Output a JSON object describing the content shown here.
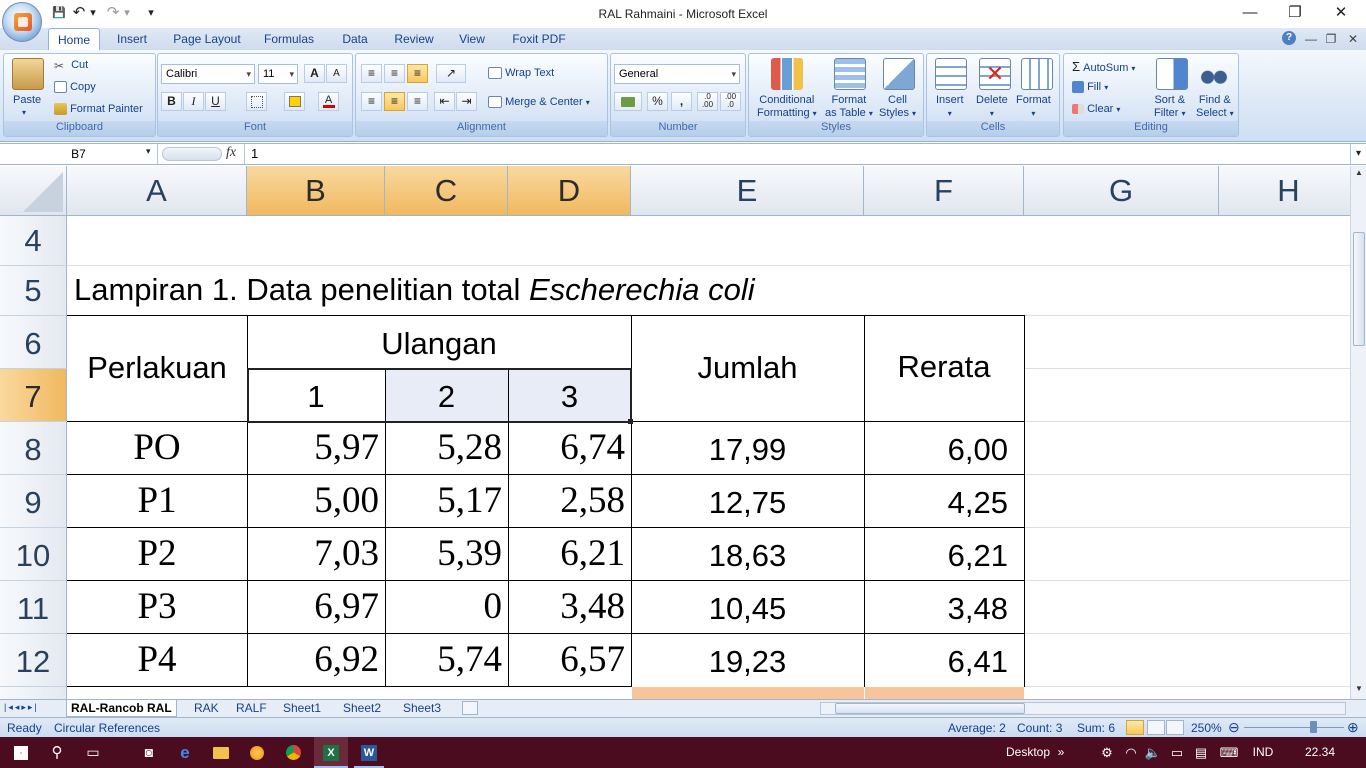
{
  "window": {
    "title": "RAL Rahmaini - Microsoft Excel",
    "minimize": "—",
    "restore": "❐",
    "close": "✕"
  },
  "qat": {
    "save": "💾",
    "undo": "↶",
    "undo_drop": "▾",
    "redo": "↷",
    "redo_drop": "▾",
    "customize": "▾"
  },
  "tabs": [
    "Home",
    "Insert",
    "Page Layout",
    "Formulas",
    "Data",
    "Review",
    "View",
    "Foxit PDF"
  ],
  "ribbon_right": {
    "help": "?",
    "min": "—",
    "restore": "❐",
    "close": "✕"
  },
  "clipboard": {
    "label": "Clipboard",
    "paste": "Paste",
    "cut": "Cut",
    "copy": "Copy",
    "format_painter": "Format Painter"
  },
  "font": {
    "label": "Font",
    "name": "Calibri",
    "size": "11",
    "bold": "B",
    "italic": "I",
    "underline": "U",
    "grow": "A",
    "shrink": "A"
  },
  "alignment": {
    "label": "Alignment",
    "wrap": "Wrap Text",
    "merge": "Merge & Center"
  },
  "number": {
    "label": "Number",
    "format": "General",
    "percent": "%",
    "comma": ",",
    "inc": ".0 .00",
    "dec": ".00 .0"
  },
  "styles": {
    "label": "Styles",
    "conditional": [
      "Conditional",
      "Formatting"
    ],
    "format_table": [
      "Format",
      "as Table"
    ],
    "cell_styles": [
      "Cell",
      "Styles"
    ]
  },
  "cells": {
    "label": "Cells",
    "insert": "Insert",
    "delete": "Delete",
    "format": "Format"
  },
  "editing": {
    "label": "Editing",
    "autosum": "AutoSum",
    "fill": "Fill",
    "clear": "Clear",
    "sort": [
      "Sort &",
      "Filter"
    ],
    "find": [
      "Find &",
      "Select"
    ]
  },
  "formula_bar": {
    "name_box": "B7",
    "fx": "fx",
    "value": "1"
  },
  "columns": [
    "A",
    "B",
    "C",
    "D",
    "E",
    "F",
    "G",
    "H"
  ],
  "rows": [
    "4",
    "5",
    "6",
    "7",
    "8",
    "9",
    "10",
    "11",
    "12"
  ],
  "sheet": {
    "title_plain": "Lampiran 1. Data penelitian total ",
    "title_italic": "Escherechia coli",
    "header_perlakuan": "Perlakuan",
    "header_ulangan": "Ulangan",
    "header_jumlah": "Jumlah",
    "header_rerata": "Rerata",
    "rep_labels": [
      "1",
      "2",
      "3"
    ],
    "data": [
      {
        "p": "PO",
        "u1": "5,97",
        "u2": "5,28",
        "u3": "6,74",
        "jumlah": "17,99",
        "rerata": "6,00"
      },
      {
        "p": "P1",
        "u1": "5,00",
        "u2": "5,17",
        "u3": "2,58",
        "jumlah": "12,75",
        "rerata": "4,25"
      },
      {
        "p": "P2",
        "u1": "7,03",
        "u2": "5,39",
        "u3": "6,21",
        "jumlah": "18,63",
        "rerata": "6,21"
      },
      {
        "p": "P3",
        "u1": "6,97",
        "u2": "0",
        "u3": "3,48",
        "jumlah": "10,45",
        "rerata": "3,48"
      },
      {
        "p": "P4",
        "u1": "6,92",
        "u2": "5,74",
        "u3": "6,57",
        "jumlah": "19,23",
        "rerata": "6,41"
      }
    ]
  },
  "sheet_tabs": [
    "RAL-Rancob RAL",
    "RAK",
    "RALF",
    "Sheet1",
    "Sheet2",
    "Sheet3"
  ],
  "status": {
    "ready": "Ready",
    "circular": "Circular References",
    "average": "Average: 2",
    "count": "Count: 3",
    "sum": "Sum: 6",
    "zoom": "250%",
    "zoom_minus": "⊖",
    "zoom_plus": "⊕"
  },
  "taskbar": {
    "desktop": "Desktop",
    "chevron": "»",
    "lang": "IND",
    "time": "22.34"
  },
  "colors": {
    "accent": "#15428b",
    "selected_header": "#f1b860",
    "taskbar": "#4b0c1f"
  }
}
